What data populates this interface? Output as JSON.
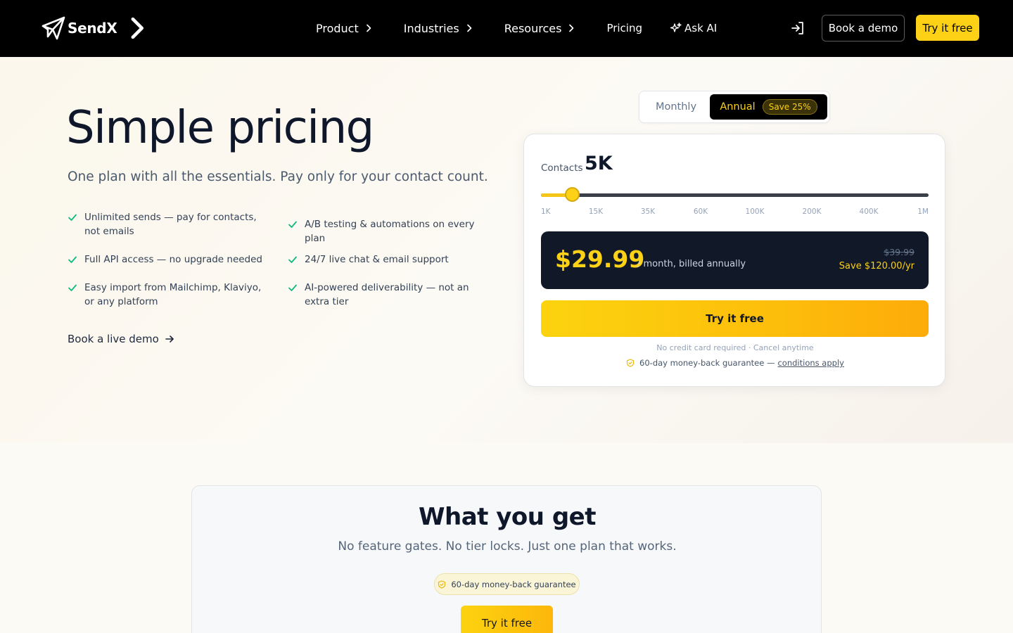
{
  "nav": {
    "brand": "SendX",
    "links": [
      {
        "label": "Product",
        "has_chevron": true
      },
      {
        "label": "Industries",
        "has_chevron": true
      },
      {
        "label": "Resources",
        "has_chevron": true
      },
      {
        "label": "Pricing",
        "has_chevron": false
      },
      {
        "label": "Ask AI",
        "icon": "sparkle-icon"
      }
    ],
    "book_demo": "Book a demo",
    "try_free": "Try it free"
  },
  "hero": {
    "title_part1": "Simple ",
    "title_highlight": "pricing",
    "subtitle": "One plan with all the essentials. Pay only for your contact count.",
    "features": [
      "Unlimited sends — pay for contacts, not emails",
      "A/B testing & automations on every plan",
      "Full API access — no upgrade needed",
      "24/7 live chat & email support",
      "Easy import from Mailchimp, Klaviyo, or any platform",
      "AI-powered deliverability — not an extra tier"
    ],
    "demo_link": "Book a live demo"
  },
  "billing_toggle": {
    "monthly": "Monthly",
    "annual": "Annual",
    "annual_badge": "Save 25%",
    "selected": "annual"
  },
  "pricing_card": {
    "contacts_label": "Contacts",
    "contacts_value": "5K",
    "slider": {
      "ticks": [
        "1K",
        "15K",
        "35K",
        "60K",
        "100K",
        "200K",
        "400K",
        "1M"
      ],
      "value_fraction": 0.08
    },
    "price": "$29.99",
    "price_period": "/ month, billed annually",
    "old_price": "$39.99",
    "savings": "Save $120.00/yr",
    "cta": "Try it free",
    "fine_print": "No credit card required · Cancel anytime",
    "guarantee": "60-day money-back guarantee —",
    "guarantee_link": "conditions apply"
  },
  "what_you_get": {
    "title": "What you get",
    "subtitle": "No feature gates. No tier locks. Just one plan that works.",
    "badge": "60-day money-back guarantee",
    "cta": "Try it free"
  },
  "colors": {
    "accent": "#fcd116",
    "nav_bg": "#000000",
    "price_box_bg": "#111827",
    "check": "#10b981"
  }
}
